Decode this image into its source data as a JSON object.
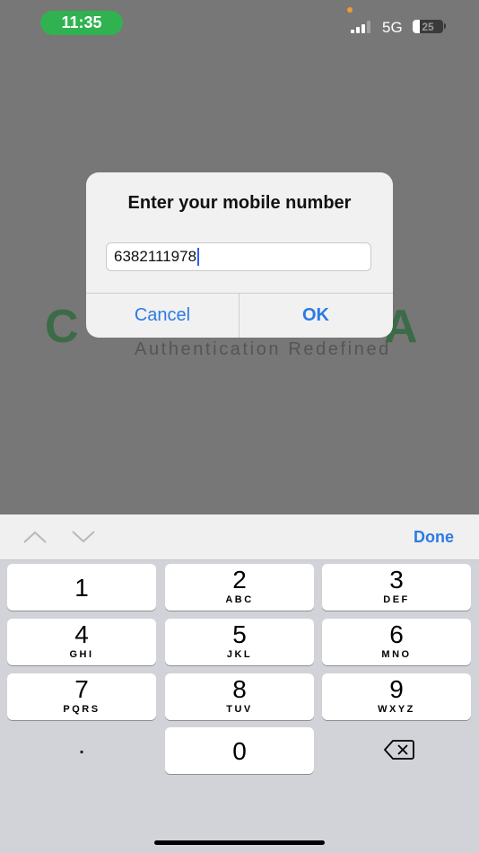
{
  "status_bar": {
    "time": "11:35",
    "network": "5G",
    "battery": "25"
  },
  "background_app": {
    "logo_left": "C",
    "logo_right": "A",
    "tagline": "Authentication Redefined"
  },
  "dialog": {
    "title": "Enter your mobile number",
    "input_value": "6382111978",
    "cancel_label": "Cancel",
    "ok_label": "OK"
  },
  "keyboard": {
    "done_label": "Done",
    "keys": [
      {
        "num": "1",
        "letters": ""
      },
      {
        "num": "2",
        "letters": "ABC"
      },
      {
        "num": "3",
        "letters": "DEF"
      },
      {
        "num": "4",
        "letters": "GHI"
      },
      {
        "num": "5",
        "letters": "JKL"
      },
      {
        "num": "6",
        "letters": "MNO"
      },
      {
        "num": "7",
        "letters": "PQRS"
      },
      {
        "num": "8",
        "letters": "TUV"
      },
      {
        "num": "9",
        "letters": "WXYZ"
      },
      {
        "num": "0",
        "letters": ""
      }
    ],
    "decimal_label": ".",
    "icons": [
      "chevron-up-icon",
      "chevron-down-icon",
      "delete-icon"
    ]
  },
  "colors": {
    "accent": "#2b7be4",
    "time_pill": "#2fb24f",
    "logo": "#3b6b47"
  }
}
